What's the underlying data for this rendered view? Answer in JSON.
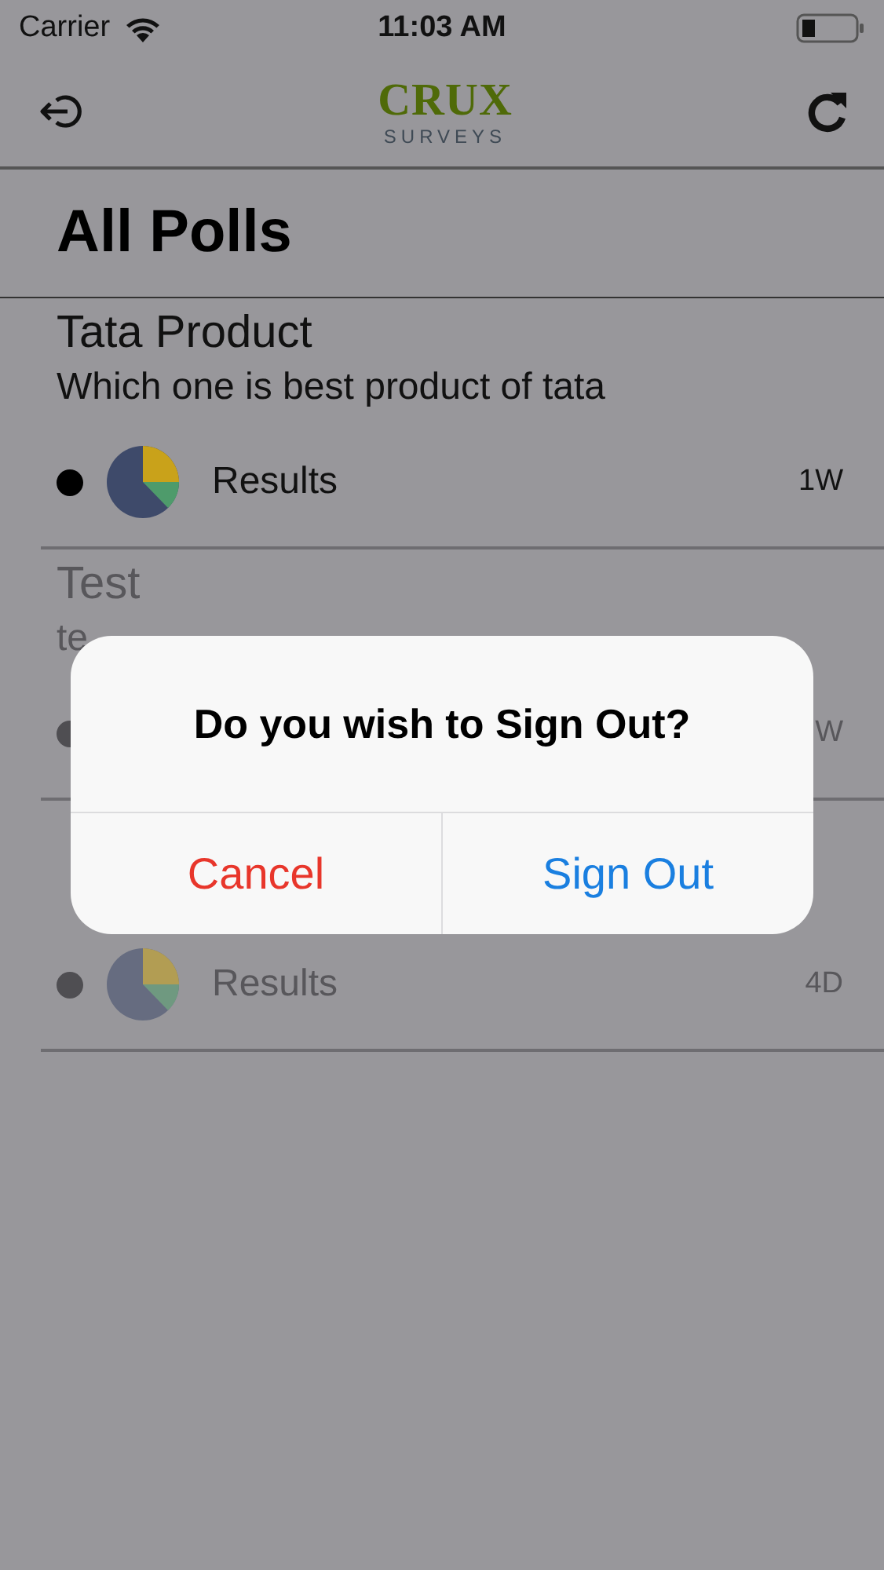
{
  "status_bar": {
    "carrier": "Carrier",
    "time": "11:03 AM"
  },
  "nav_bar": {
    "logo": {
      "name": "CRUX",
      "tagline": "SURVEYS"
    }
  },
  "page_title": "All Polls",
  "polls": [
    {
      "title": "Tata Product",
      "subtitle": "Which one is best product of tata",
      "results_label": "Results",
      "time": "1W",
      "read": false
    },
    {
      "title": "Test",
      "subtitle": "te",
      "time": "W",
      "read": true
    },
    {
      "results_label": "Results",
      "time": "4D",
      "read": true
    }
  ],
  "alert": {
    "title": "Do you wish to Sign Out?",
    "buttons": [
      {
        "label": "Cancel",
        "kind": "destructive"
      },
      {
        "label": "Sign Out",
        "kind": "default"
      }
    ]
  }
}
